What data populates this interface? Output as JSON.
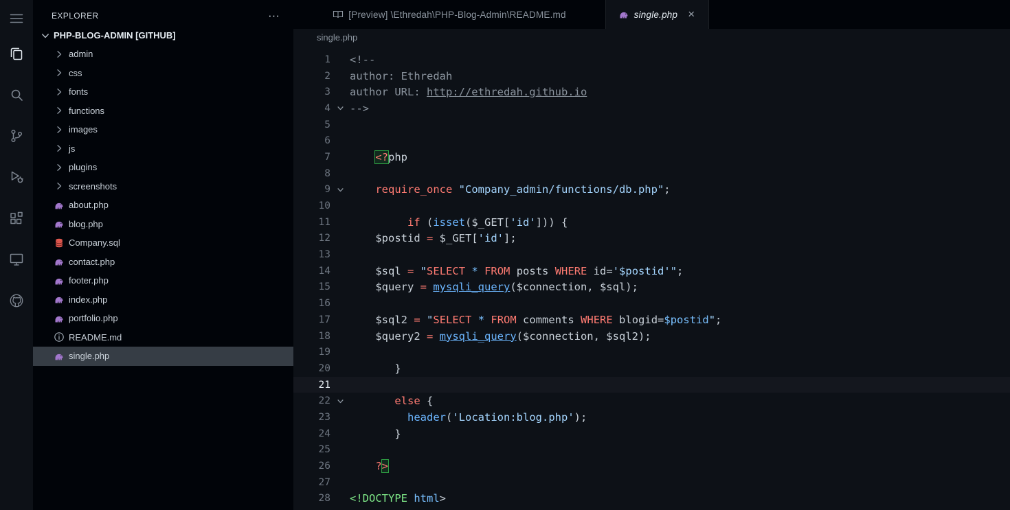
{
  "colors": {
    "fg": "#c9d1d9",
    "comment": "#8b949e",
    "kw": "#ff7b72",
    "str": "#a5d6ff",
    "fn": "#6cb6ff",
    "const": "#79c0ff",
    "ent": "#7ee787",
    "php_icon": "#a277cc",
    "sql_icon": "#e0584f",
    "selection_bg": "#363d45",
    "bracket_match": "#2ea043"
  },
  "activity_bar": {
    "icons": [
      "menu",
      "files",
      "search",
      "source-control",
      "run-debug",
      "extensions",
      "remote-explorer",
      "github"
    ],
    "active_icon": "files"
  },
  "sidebar": {
    "title": "EXPLORER",
    "actions": "···",
    "root": {
      "label": "PHP-BLOG-ADMIN [GITHUB]"
    },
    "items": [
      {
        "label": "admin",
        "kind": "folder"
      },
      {
        "label": "css",
        "kind": "folder"
      },
      {
        "label": "fonts",
        "kind": "folder"
      },
      {
        "label": "functions",
        "kind": "folder"
      },
      {
        "label": "images",
        "kind": "folder"
      },
      {
        "label": "js",
        "kind": "folder"
      },
      {
        "label": "plugins",
        "kind": "folder"
      },
      {
        "label": "screenshots",
        "kind": "folder"
      },
      {
        "label": "about.php",
        "kind": "php"
      },
      {
        "label": "blog.php",
        "kind": "php"
      },
      {
        "label": "Company.sql",
        "kind": "sql"
      },
      {
        "label": "contact.php",
        "kind": "php"
      },
      {
        "label": "footer.php",
        "kind": "php"
      },
      {
        "label": "index.php",
        "kind": "php"
      },
      {
        "label": "portfolio.php",
        "kind": "php"
      },
      {
        "label": "README.md",
        "kind": "info"
      },
      {
        "label": "single.php",
        "kind": "php",
        "selected": true
      }
    ]
  },
  "tabs": [
    {
      "title": "[Preview] \\Ethredah\\PHP-Blog-Admin\\README.md",
      "icon": "preview",
      "active": false,
      "italic": false
    },
    {
      "title": "single.php",
      "icon": "php",
      "active": true,
      "italic": true,
      "close": "×"
    }
  ],
  "breadcrumb": {
    "label": "single.php"
  },
  "editor": {
    "active_line": 21,
    "folds": [
      4,
      9,
      22
    ],
    "lines": [
      [
        {
          "t": "<!--",
          "c": "comment"
        }
      ],
      [
        {
          "t": "author: Ethredah",
          "c": "comment"
        }
      ],
      [
        {
          "t": "author URL: ",
          "c": "comment"
        },
        {
          "t": "http://ethredah.github.io",
          "c": "comment",
          "u": true
        }
      ],
      [
        {
          "t": "-->",
          "c": "comment"
        }
      ],
      [],
      [],
      [
        {
          "t": "    ",
          "c": "fg"
        },
        {
          "t": "<?",
          "c": "kw",
          "box": true
        },
        {
          "t": "php",
          "c": "fg"
        }
      ],
      [],
      [
        {
          "t": "    ",
          "c": "fg"
        },
        {
          "t": "require_once",
          "c": "kw"
        },
        {
          "t": " ",
          "c": "fg"
        },
        {
          "t": "\"Company_admin/functions/db.php\"",
          "c": "str"
        },
        {
          "t": ";",
          "c": "fg"
        }
      ],
      [],
      [
        {
          "t": "         ",
          "c": "fg"
        },
        {
          "t": "if",
          "c": "kw"
        },
        {
          "t": " (",
          "c": "fg"
        },
        {
          "t": "isset",
          "c": "fn"
        },
        {
          "t": "(",
          "c": "fg"
        },
        {
          "t": "$_GET",
          "c": "fg"
        },
        {
          "t": "[",
          "c": "fg"
        },
        {
          "t": "'id'",
          "c": "str"
        },
        {
          "t": "])) {",
          "c": "fg"
        }
      ],
      [
        {
          "t": "    ",
          "c": "fg"
        },
        {
          "t": "$postid ",
          "c": "fg"
        },
        {
          "t": "=",
          "c": "kw"
        },
        {
          "t": " $_GET[",
          "c": "fg"
        },
        {
          "t": "'id'",
          "c": "str"
        },
        {
          "t": "];",
          "c": "fg"
        }
      ],
      [],
      [
        {
          "t": "    ",
          "c": "fg"
        },
        {
          "t": "$sql ",
          "c": "fg"
        },
        {
          "t": "=",
          "c": "kw"
        },
        {
          "t": " ",
          "c": "fg"
        },
        {
          "t": "\"",
          "c": "str"
        },
        {
          "t": "SELECT",
          "c": "kw"
        },
        {
          "t": " ",
          "c": "str"
        },
        {
          "t": "*",
          "c": "const"
        },
        {
          "t": " ",
          "c": "str"
        },
        {
          "t": "FROM",
          "c": "kw"
        },
        {
          "t": " posts ",
          "c": "fg"
        },
        {
          "t": "WHERE",
          "c": "kw"
        },
        {
          "t": " id=",
          "c": "fg"
        },
        {
          "t": "'$postid'\"",
          "c": "str"
        },
        {
          "t": ";",
          "c": "fg"
        }
      ],
      [
        {
          "t": "    ",
          "c": "fg"
        },
        {
          "t": "$query ",
          "c": "fg"
        },
        {
          "t": "=",
          "c": "kw"
        },
        {
          "t": " ",
          "c": "fg"
        },
        {
          "t": "mysqli_query",
          "c": "fn",
          "u": true
        },
        {
          "t": "($connection, $sql);",
          "c": "fg"
        }
      ],
      [],
      [
        {
          "t": "    ",
          "c": "fg"
        },
        {
          "t": "$sql2 ",
          "c": "fg"
        },
        {
          "t": "=",
          "c": "kw"
        },
        {
          "t": " ",
          "c": "fg"
        },
        {
          "t": "\"",
          "c": "str"
        },
        {
          "t": "SELECT",
          "c": "kw"
        },
        {
          "t": " ",
          "c": "str"
        },
        {
          "t": "*",
          "c": "const"
        },
        {
          "t": " ",
          "c": "str"
        },
        {
          "t": "FROM",
          "c": "kw"
        },
        {
          "t": " comments ",
          "c": "fg"
        },
        {
          "t": "WHERE",
          "c": "kw"
        },
        {
          "t": " blogid=",
          "c": "fg"
        },
        {
          "t": "$postid",
          "c": "const"
        },
        {
          "t": "\"",
          "c": "str"
        },
        {
          "t": ";",
          "c": "fg"
        }
      ],
      [
        {
          "t": "    ",
          "c": "fg"
        },
        {
          "t": "$query2 ",
          "c": "fg"
        },
        {
          "t": "=",
          "c": "kw"
        },
        {
          "t": " ",
          "c": "fg"
        },
        {
          "t": "mysqli_query",
          "c": "fn",
          "u": true
        },
        {
          "t": "($connection, $sql2);",
          "c": "fg"
        }
      ],
      [],
      [
        {
          "t": "       }",
          "c": "fg"
        }
      ],
      [],
      [
        {
          "t": "       ",
          "c": "fg"
        },
        {
          "t": "else",
          "c": "kw"
        },
        {
          "t": " {",
          "c": "fg"
        }
      ],
      [
        {
          "t": "         ",
          "c": "fg"
        },
        {
          "t": "header",
          "c": "fn"
        },
        {
          "t": "(",
          "c": "fg"
        },
        {
          "t": "'Location:blog.php'",
          "c": "str"
        },
        {
          "t": ");",
          "c": "fg"
        }
      ],
      [
        {
          "t": "       }",
          "c": "fg"
        }
      ],
      [],
      [
        {
          "t": "    ",
          "c": "fg"
        },
        {
          "t": "?",
          "c": "kw"
        },
        {
          "t": ">",
          "c": "kw",
          "box": true
        }
      ],
      [],
      [
        {
          "t": "<!DOCTYPE",
          "c": "ent"
        },
        {
          "t": " ",
          "c": "fg"
        },
        {
          "t": "html",
          "c": "const"
        },
        {
          "t": ">",
          "c": "fg"
        }
      ]
    ]
  }
}
